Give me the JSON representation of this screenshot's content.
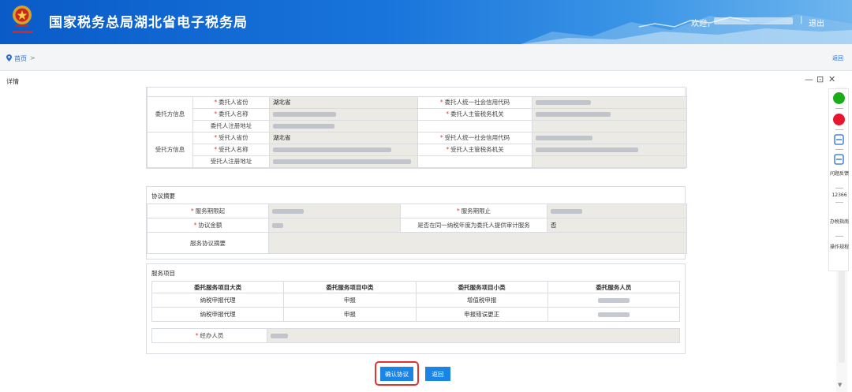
{
  "header": {
    "title": "国家税务总局湖北省电子税务局",
    "welcome": "欢迎，",
    "separator": "|",
    "logout": "退出"
  },
  "breadcrumb": {
    "home": "首页",
    "arrow": ">",
    "back": "返回"
  },
  "window": {
    "title": "详情",
    "minimize": "—",
    "restore": "⊡",
    "close": "✕"
  },
  "principal": {
    "group": "委托方信息",
    "province_label": "委托人省份",
    "province": "湖北省",
    "credit_code_label": "委托人统一社会信用代码",
    "name_label": "委托人名称",
    "tax_authority_label": "委托人主管税务机关",
    "address_label": "委托人注册地址"
  },
  "agent": {
    "group": "受托方信息",
    "province_label": "受托人省份",
    "province": "湖北省",
    "credit_code_label": "受托人统一社会信用代码",
    "name_label": "受托人名称",
    "tax_authority_label": "受托人主管税务机关",
    "address_label": "受托人注册地址"
  },
  "summary": {
    "title": "协议摘要",
    "start_label": "服务期限起",
    "end_label": "服务期限止",
    "amount_label": "协议金额",
    "audit_label": "是否在同一纳税年度为委托人提供审计服务",
    "audit_value": "否",
    "desc_label": "服务协议摘要"
  },
  "services": {
    "title": "服务项目",
    "headers": [
      "委托服务项目大类",
      "委托服务项目中类",
      "委托服务项目小类",
      "委托服务人员"
    ],
    "rows": [
      [
        "纳税申报代理",
        "申报",
        "增值税申报"
      ],
      [
        "纳税申报代理",
        "申报",
        "申报错误更正"
      ]
    ],
    "handler_label": "经办人员"
  },
  "buttons": {
    "confirm": "确认协议",
    "back": "返回"
  },
  "toolbar": {
    "feedback": "问题反馈",
    "hotline": "12366",
    "guide": "办税指南",
    "tutorial": "操作规程"
  },
  "colors": {
    "brand_blue": "#1b84e7",
    "required_red": "#e23b2e",
    "highlight_red": "#e5322d"
  }
}
